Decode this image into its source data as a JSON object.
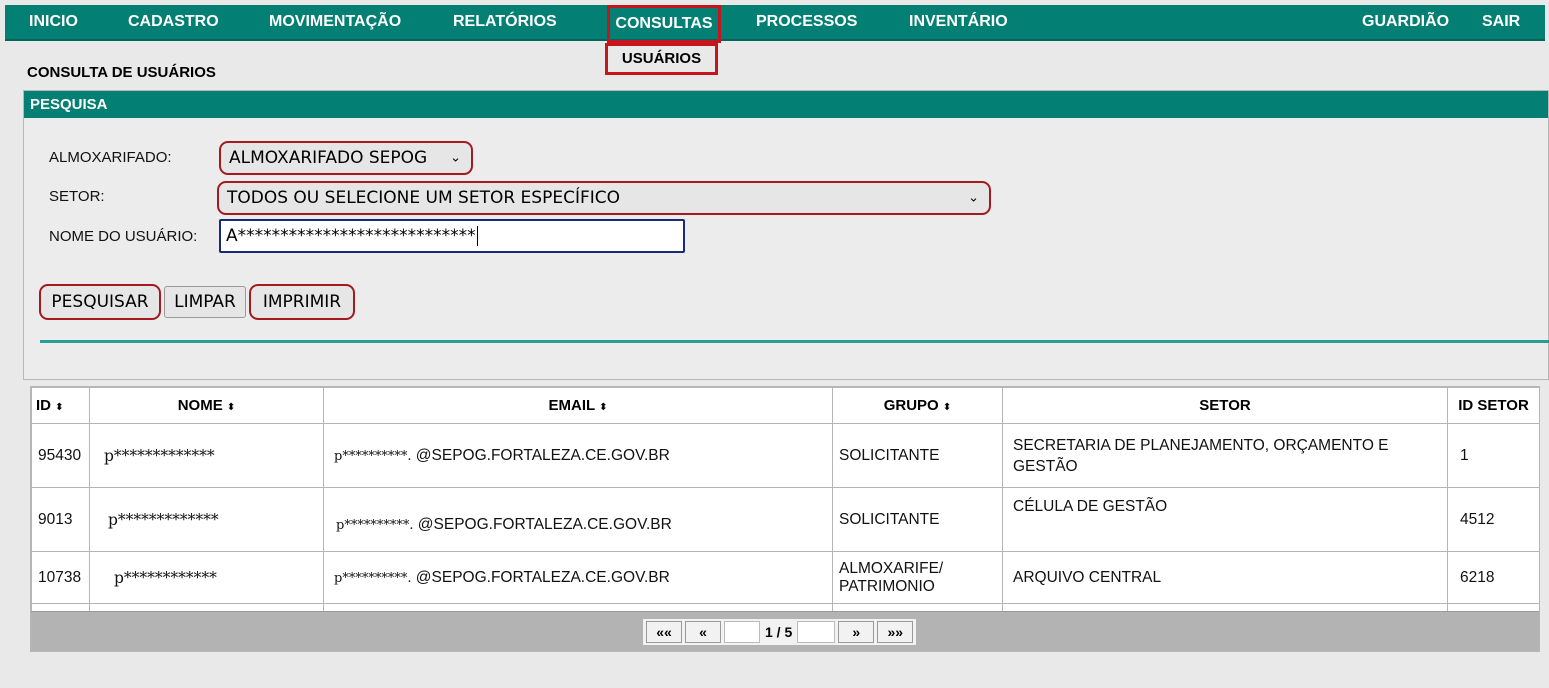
{
  "nav": {
    "items": [
      "INICIO",
      "CADASTRO",
      "MOVIMENTAÇÃO",
      "RELATÓRIOS",
      "CONSULTAS",
      "PROCESSOS",
      "INVENTÁRIO"
    ],
    "right_items": [
      "GUARDIÃO",
      "SAIR"
    ],
    "submenu_item": "USUÁRIOS"
  },
  "page": {
    "title": "CONSULTA DE USUÁRIOS"
  },
  "search": {
    "header": "PESQUISA",
    "almox_label": "ALMOXARIFADO:",
    "almox_value": "ALMOXARIFADO SEPOG",
    "setor_label": "SETOR:",
    "setor_value": "TODOS OU SELECIONE UM SETOR ESPECÍFICO",
    "user_label": "NOME DO USUÁRIO:",
    "user_value": "A****************************",
    "buttons": {
      "search": "PESQUISAR",
      "clear": "LIMPAR",
      "print": "IMPRIMIR"
    }
  },
  "table": {
    "columns": [
      "ID",
      "NOME",
      "EMAIL",
      "GRUPO",
      "SETOR",
      "ID SETOR"
    ],
    "sort_icon": "⬍",
    "rows": [
      {
        "id": "95430",
        "nome": "p*************",
        "email_mask": "p**********.",
        "email_domain": "@SEPOG.FORTALEZA.CE.GOV.BR",
        "grupo": "SOLICITANTE",
        "setor": "SECRETARIA DE PLANEJAMENTO, ORÇAMENTO E GESTÃO",
        "id_setor": "1"
      },
      {
        "id": "9013",
        "nome": "p*************",
        "email_mask": "p**********.",
        "email_domain": "@SEPOG.FORTALEZA.CE.GOV.BR",
        "grupo": "SOLICITANTE",
        "setor": "CÉLULA DE GESTÃO",
        "id_setor": "4512"
      },
      {
        "id": "10738",
        "nome": "p************",
        "email_mask": "p**********.",
        "email_domain": "@SEPOG.FORTALEZA.CE.GOV.BR",
        "grupo": "ALMOXARIFE/ PATRIMONIO",
        "setor": "ARQUIVO CENTRAL",
        "id_setor": "6218"
      }
    ]
  },
  "pager": {
    "first": "««",
    "prev": "«",
    "label": "1 / 5",
    "next": "»",
    "last": "»»"
  }
}
